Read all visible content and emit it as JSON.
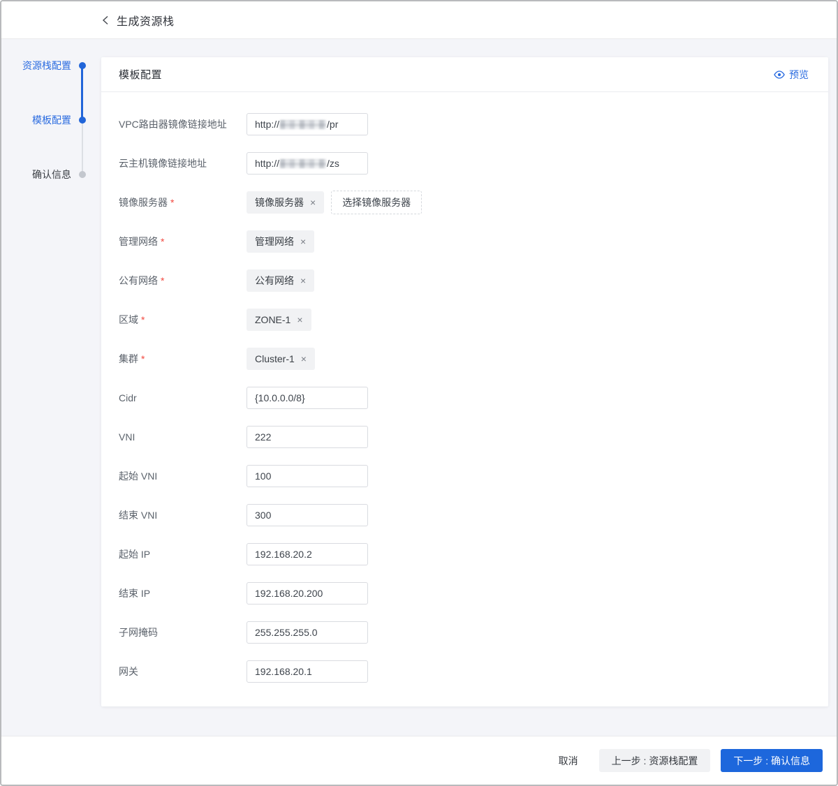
{
  "header": {
    "title": "生成资源栈"
  },
  "steps": {
    "items": [
      {
        "label": "资源栈配置",
        "state": "done"
      },
      {
        "label": "模板配置",
        "state": "active"
      },
      {
        "label": "确认信息",
        "state": "pending"
      }
    ]
  },
  "panel": {
    "title": "模板配置",
    "preview_label": "预览"
  },
  "form": {
    "required_marker": "*",
    "fields": [
      {
        "label": "VPC路由器镜像链接地址",
        "required": false,
        "type": "url",
        "value_prefix": "http://",
        "redacted": true,
        "value_suffix": "/pr"
      },
      {
        "label": "云主机镜像链接地址",
        "required": false,
        "type": "url",
        "value_prefix": "http://",
        "redacted": true,
        "value_suffix": "/zs"
      },
      {
        "label": "镜像服务器",
        "required": true,
        "type": "tag",
        "tag": "镜像服务器",
        "button": "选择镜像服务器"
      },
      {
        "label": "管理网络",
        "required": true,
        "type": "tag",
        "tag": "管理网络"
      },
      {
        "label": "公有网络",
        "required": true,
        "type": "tag",
        "tag": "公有网络"
      },
      {
        "label": "区域",
        "required": true,
        "type": "tag",
        "tag": "ZONE-1"
      },
      {
        "label": "集群",
        "required": true,
        "type": "tag",
        "tag": "Cluster-1"
      },
      {
        "label": "Cidr",
        "required": false,
        "type": "text",
        "value": "{10.0.0.0/8}"
      },
      {
        "label": "VNI",
        "required": false,
        "type": "text",
        "value": "222"
      },
      {
        "label": "起始 VNI",
        "required": false,
        "type": "text",
        "value": "100"
      },
      {
        "label": "结束 VNI",
        "required": false,
        "type": "text",
        "value": "300"
      },
      {
        "label": "起始 IP",
        "required": false,
        "type": "text",
        "value": "192.168.20.2"
      },
      {
        "label": "结束 IP",
        "required": false,
        "type": "text",
        "value": "192.168.20.200"
      },
      {
        "label": "子网掩码",
        "required": false,
        "type": "text",
        "value": "255.255.255.0"
      },
      {
        "label": "网关",
        "required": false,
        "type": "text",
        "value": "192.168.20.1"
      }
    ]
  },
  "footer": {
    "cancel_label": "取消",
    "prev_label": "上一步 : 资源栈配置",
    "next_label": "下一步 : 确认信息"
  },
  "icons": {
    "back": "‹",
    "tag_close": "×",
    "eye": "eye-icon"
  },
  "colors": {
    "accent_blue": "#2165d9",
    "link_blue": "#2b6ce0",
    "button_blue": "#1d67dc",
    "page_bg": "#f4f5f9",
    "required_red": "#f2483f",
    "pending_gray": "#c3c7ce"
  }
}
